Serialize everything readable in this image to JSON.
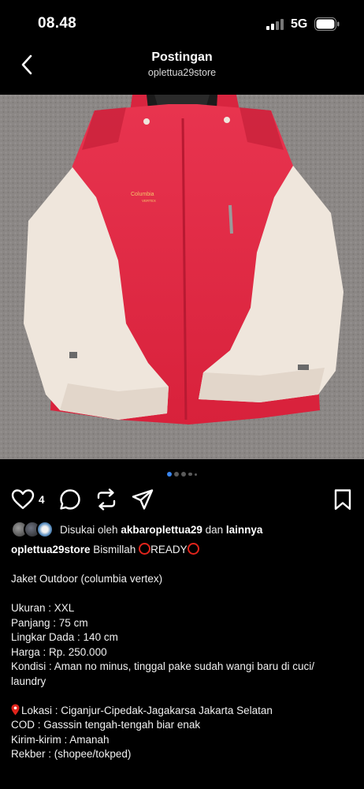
{
  "status": {
    "time": "08.48",
    "network": "5G"
  },
  "header": {
    "title": "Postingan",
    "subtitle": "oplettua29store"
  },
  "photo": {
    "subject": "jacket-photo",
    "brand_label": "Columbia",
    "sub_label": "VERTEX"
  },
  "carousel": {
    "dots": 5,
    "active": 0
  },
  "actions": {
    "like_count": "4"
  },
  "liked_by": {
    "prefix": "Disukai oleh",
    "user": "akbaroplettua29",
    "mid": "dan",
    "others": "lainnya"
  },
  "caption": {
    "username": "oplettua29store",
    "first_text": "Bismillah",
    "ready": "READY",
    "lines": {
      "title": "Jaket Outdoor (columbia vertex)",
      "size": "Ukuran : XXL",
      "length": "Panjang : 75 cm",
      "chest": "Lingkar Dada : 140 cm",
      "price": "Harga : Rp. 250.000",
      "condition_1": "Kondisi : Aman no minus, tinggal pake sudah wangi baru di cuci/",
      "condition_2": "laundry",
      "location": "Lokasi : Ciganjur-Cipedak-Jagakarsa Jakarta Selatan",
      "cod": "COD : Gasssin tengah-tengah biar enak",
      "shipping": "Kirim-kirim : Amanah",
      "rekber": "Rekber : (shopee/tokped)"
    }
  },
  "colors": {
    "accent_blue": "#3a86f0",
    "ring_red": "#e0241b",
    "jacket_red": "#e22a45",
    "jacket_cream": "#efe6dc"
  }
}
